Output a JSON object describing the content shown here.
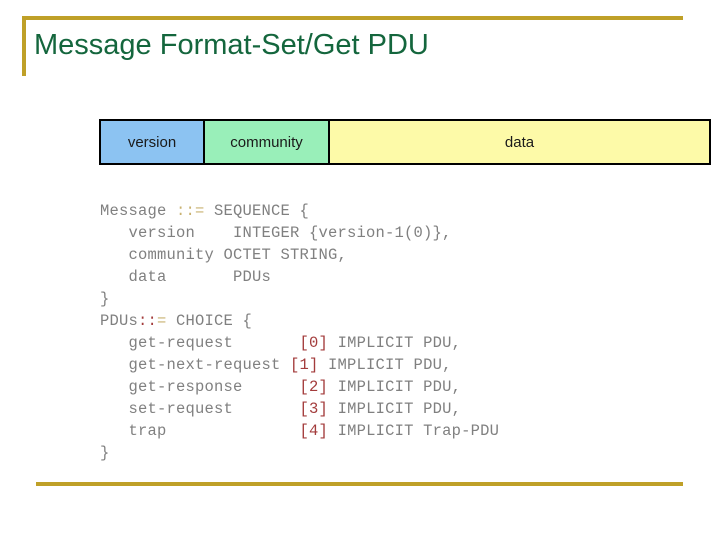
{
  "slide": {
    "title": "Message Format-Set/Get PDU",
    "title_color": "#14663d",
    "accent_color": "#bfa028",
    "background_color": "#ffffff"
  },
  "pdu_table": {
    "cells": [
      {
        "label": "version",
        "color": "#8cc3f2"
      },
      {
        "label": "community",
        "color": "#99efb9"
      },
      {
        "label": "data",
        "color": "#fdfaa8"
      }
    ],
    "border_color": "#000000"
  },
  "asn_code": {
    "text_color": "#808080",
    "assign_color": "#c9b271",
    "tag_color": "#a33c3c",
    "lines": {
      "l01_head": "Message ",
      "l01_assign": "::=",
      "l01_tail": " SEQUENCE {",
      "l02": "   version    INTEGER {version-1(0)},",
      "l03": "   community OCTET STRING,",
      "l04": "   data       PDUs",
      "l05": "}",
      "l06_head": "PDUs",
      "l06_colons": "::",
      "l06_eq": "=",
      "l06_tail": " CHOICE {",
      "l07_name": "   get-request       ",
      "l07_tag": "[0]",
      "l07_tail": " IMPLICIT PDU,",
      "l08_name": "   get-next-request ",
      "l08_tag": "[1]",
      "l08_tail": " IMPLICIT PDU,",
      "l09_name": "   get-response      ",
      "l09_tag": "[2]",
      "l09_tail": " IMPLICIT PDU,",
      "l10_name": "   set-request       ",
      "l10_tag": "[3]",
      "l10_tail": " IMPLICIT PDU,",
      "l11_name": "   trap              ",
      "l11_tag": "[4]",
      "l11_tail": " IMPLICIT Trap-PDU",
      "l12": "}"
    }
  }
}
